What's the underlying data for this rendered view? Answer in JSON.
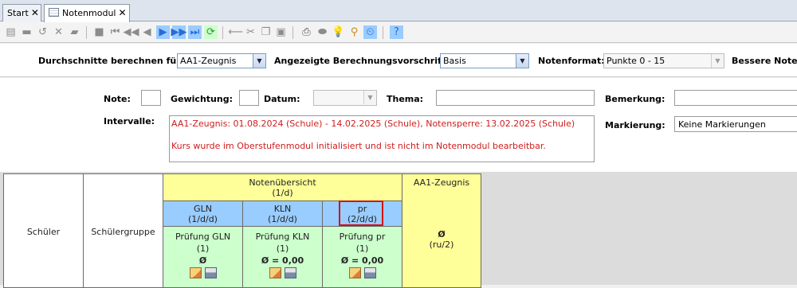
{
  "tabs": [
    {
      "label": "Start",
      "close": "✕"
    },
    {
      "label": "Notenmodul",
      "close": "✕"
    }
  ],
  "filters": {
    "averages_label": "Durchschnitte berechnen für:",
    "averages_value": "AA1-Zeugnis",
    "rule_label": "Angezeigte Berechnungsvorschrift:",
    "rule_value": "Basis",
    "format_label": "Notenformat:",
    "format_value": "Punkte 0 - 15",
    "better_label": "Bessere Note b"
  },
  "form": {
    "note_label": "Note:",
    "weight_label": "Gewichtung:",
    "date_label": "Datum:",
    "topic_label": "Thema:",
    "remark_label": "Bemerkung:",
    "interval_label": "Intervalle:",
    "interval_lines": [
      "AA1-Zeugnis: 01.08.2024 (Schule) - 14.02.2025 (Schule), Notensperre: 13.02.2025 (Schule)",
      "Kurs wurde im Oberstufenmodul initialisiert und ist nicht im Notenmodul bearbeitbar."
    ],
    "marking_label": "Markierung:",
    "marking_value": "Keine Markierungen"
  },
  "grid": {
    "student_header": "Schüler",
    "group_header": "Schülergruppe",
    "overview_title": "Notenübersicht",
    "overview_sub": "(1/d)",
    "report_title": "AA1-Zeugnis",
    "report_avg": "Ø",
    "report_sub": "(ru/2)",
    "columns": [
      {
        "name": "GLN",
        "sub": "(1/d/d)",
        "exam": "Prüfung GLN",
        "count": "(1)",
        "avg": "Ø"
      },
      {
        "name": "KLN",
        "sub": "(1/d/d)",
        "exam": "Prüfung KLN",
        "count": "(1)",
        "avg": "Ø = 0,00"
      },
      {
        "name": "pr",
        "sub": "(2/d/d)",
        "exam": "Prüfung pr",
        "count": "(1)",
        "avg": "Ø = 0,00"
      }
    ]
  },
  "colors": {
    "accent_red": "#d01c1c",
    "highlight": "#d01515"
  }
}
